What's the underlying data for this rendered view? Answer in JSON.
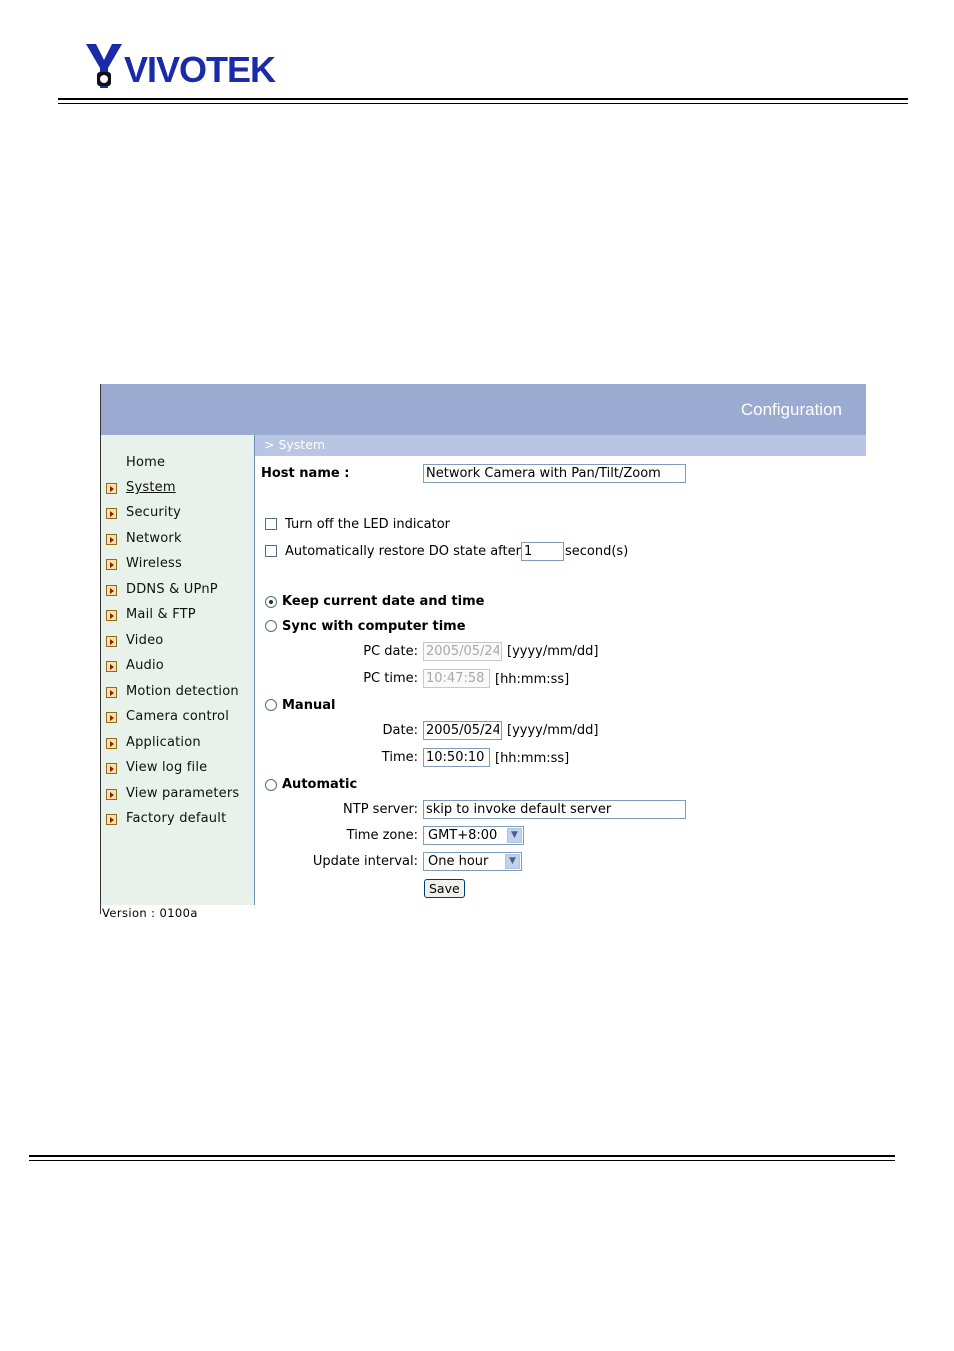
{
  "logo": {
    "text": "VIVOTEK"
  },
  "header": {
    "title": "Configuration"
  },
  "breadcrumb": "> System",
  "sidebar": {
    "items": [
      {
        "label": "Home",
        "icon": ""
      },
      {
        "label": "System",
        "icon": "arrow-icon"
      },
      {
        "label": "Security",
        "icon": "arrow-icon"
      },
      {
        "label": "Network",
        "icon": "arrow-icon"
      },
      {
        "label": "Wireless",
        "icon": "arrow-icon"
      },
      {
        "label": "DDNS & UPnP",
        "icon": "arrow-icon"
      },
      {
        "label": "Mail & FTP",
        "icon": "arrow-icon"
      },
      {
        "label": "Video",
        "icon": "arrow-icon"
      },
      {
        "label": "Audio",
        "icon": "arrow-icon"
      },
      {
        "label": "Motion detection",
        "icon": "arrow-icon"
      },
      {
        "label": "Camera control",
        "icon": "arrow-icon"
      },
      {
        "label": "Application",
        "icon": "arrow-icon"
      },
      {
        "label": "View log file",
        "icon": "arrow-icon"
      },
      {
        "label": "View parameters",
        "icon": "arrow-icon"
      },
      {
        "label": "Factory default",
        "icon": "arrow-icon"
      }
    ],
    "version": "Version : 0100a"
  },
  "form": {
    "host_name_label": "Host name :",
    "host_name_value": "Network Camera with Pan/Tilt/Zoom",
    "led_label": "Turn off the LED indicator",
    "led_checked": false,
    "restore_do_label": "Automatically restore DO state after",
    "restore_do_checked": false,
    "restore_do_value": "1",
    "restore_do_unit": "second(s)",
    "keep_label": "Keep current date and time",
    "sync_label": "Sync with computer time",
    "pc_date_label": "PC date:",
    "pc_date_value": "2005/05/24",
    "pc_date_format": "[yyyy/mm/dd]",
    "pc_time_label": "PC time:",
    "pc_time_value": "10:47:58",
    "pc_time_format": "[hh:mm:ss]",
    "manual_label": "Manual",
    "date_label": "Date:",
    "date_value": "2005/05/24",
    "date_format": "[yyyy/mm/dd]",
    "time_label": "Time:",
    "time_value": "10:50:10",
    "time_format": "[hh:mm:ss]",
    "automatic_label": "Automatic",
    "ntp_label": "NTP server:",
    "ntp_value": "skip to invoke default server",
    "tz_label": "Time zone:",
    "tz_value": "GMT+8:00",
    "interval_label": "Update interval:",
    "interval_value": "One hour",
    "save_label": "Save",
    "selected_mode": "keep"
  },
  "colors": {
    "header": "#9aaad0",
    "sidebar": "#e8f1ea",
    "breadcrumb_bar": "#b8c6e4",
    "logo": "#1a2ba8"
  }
}
